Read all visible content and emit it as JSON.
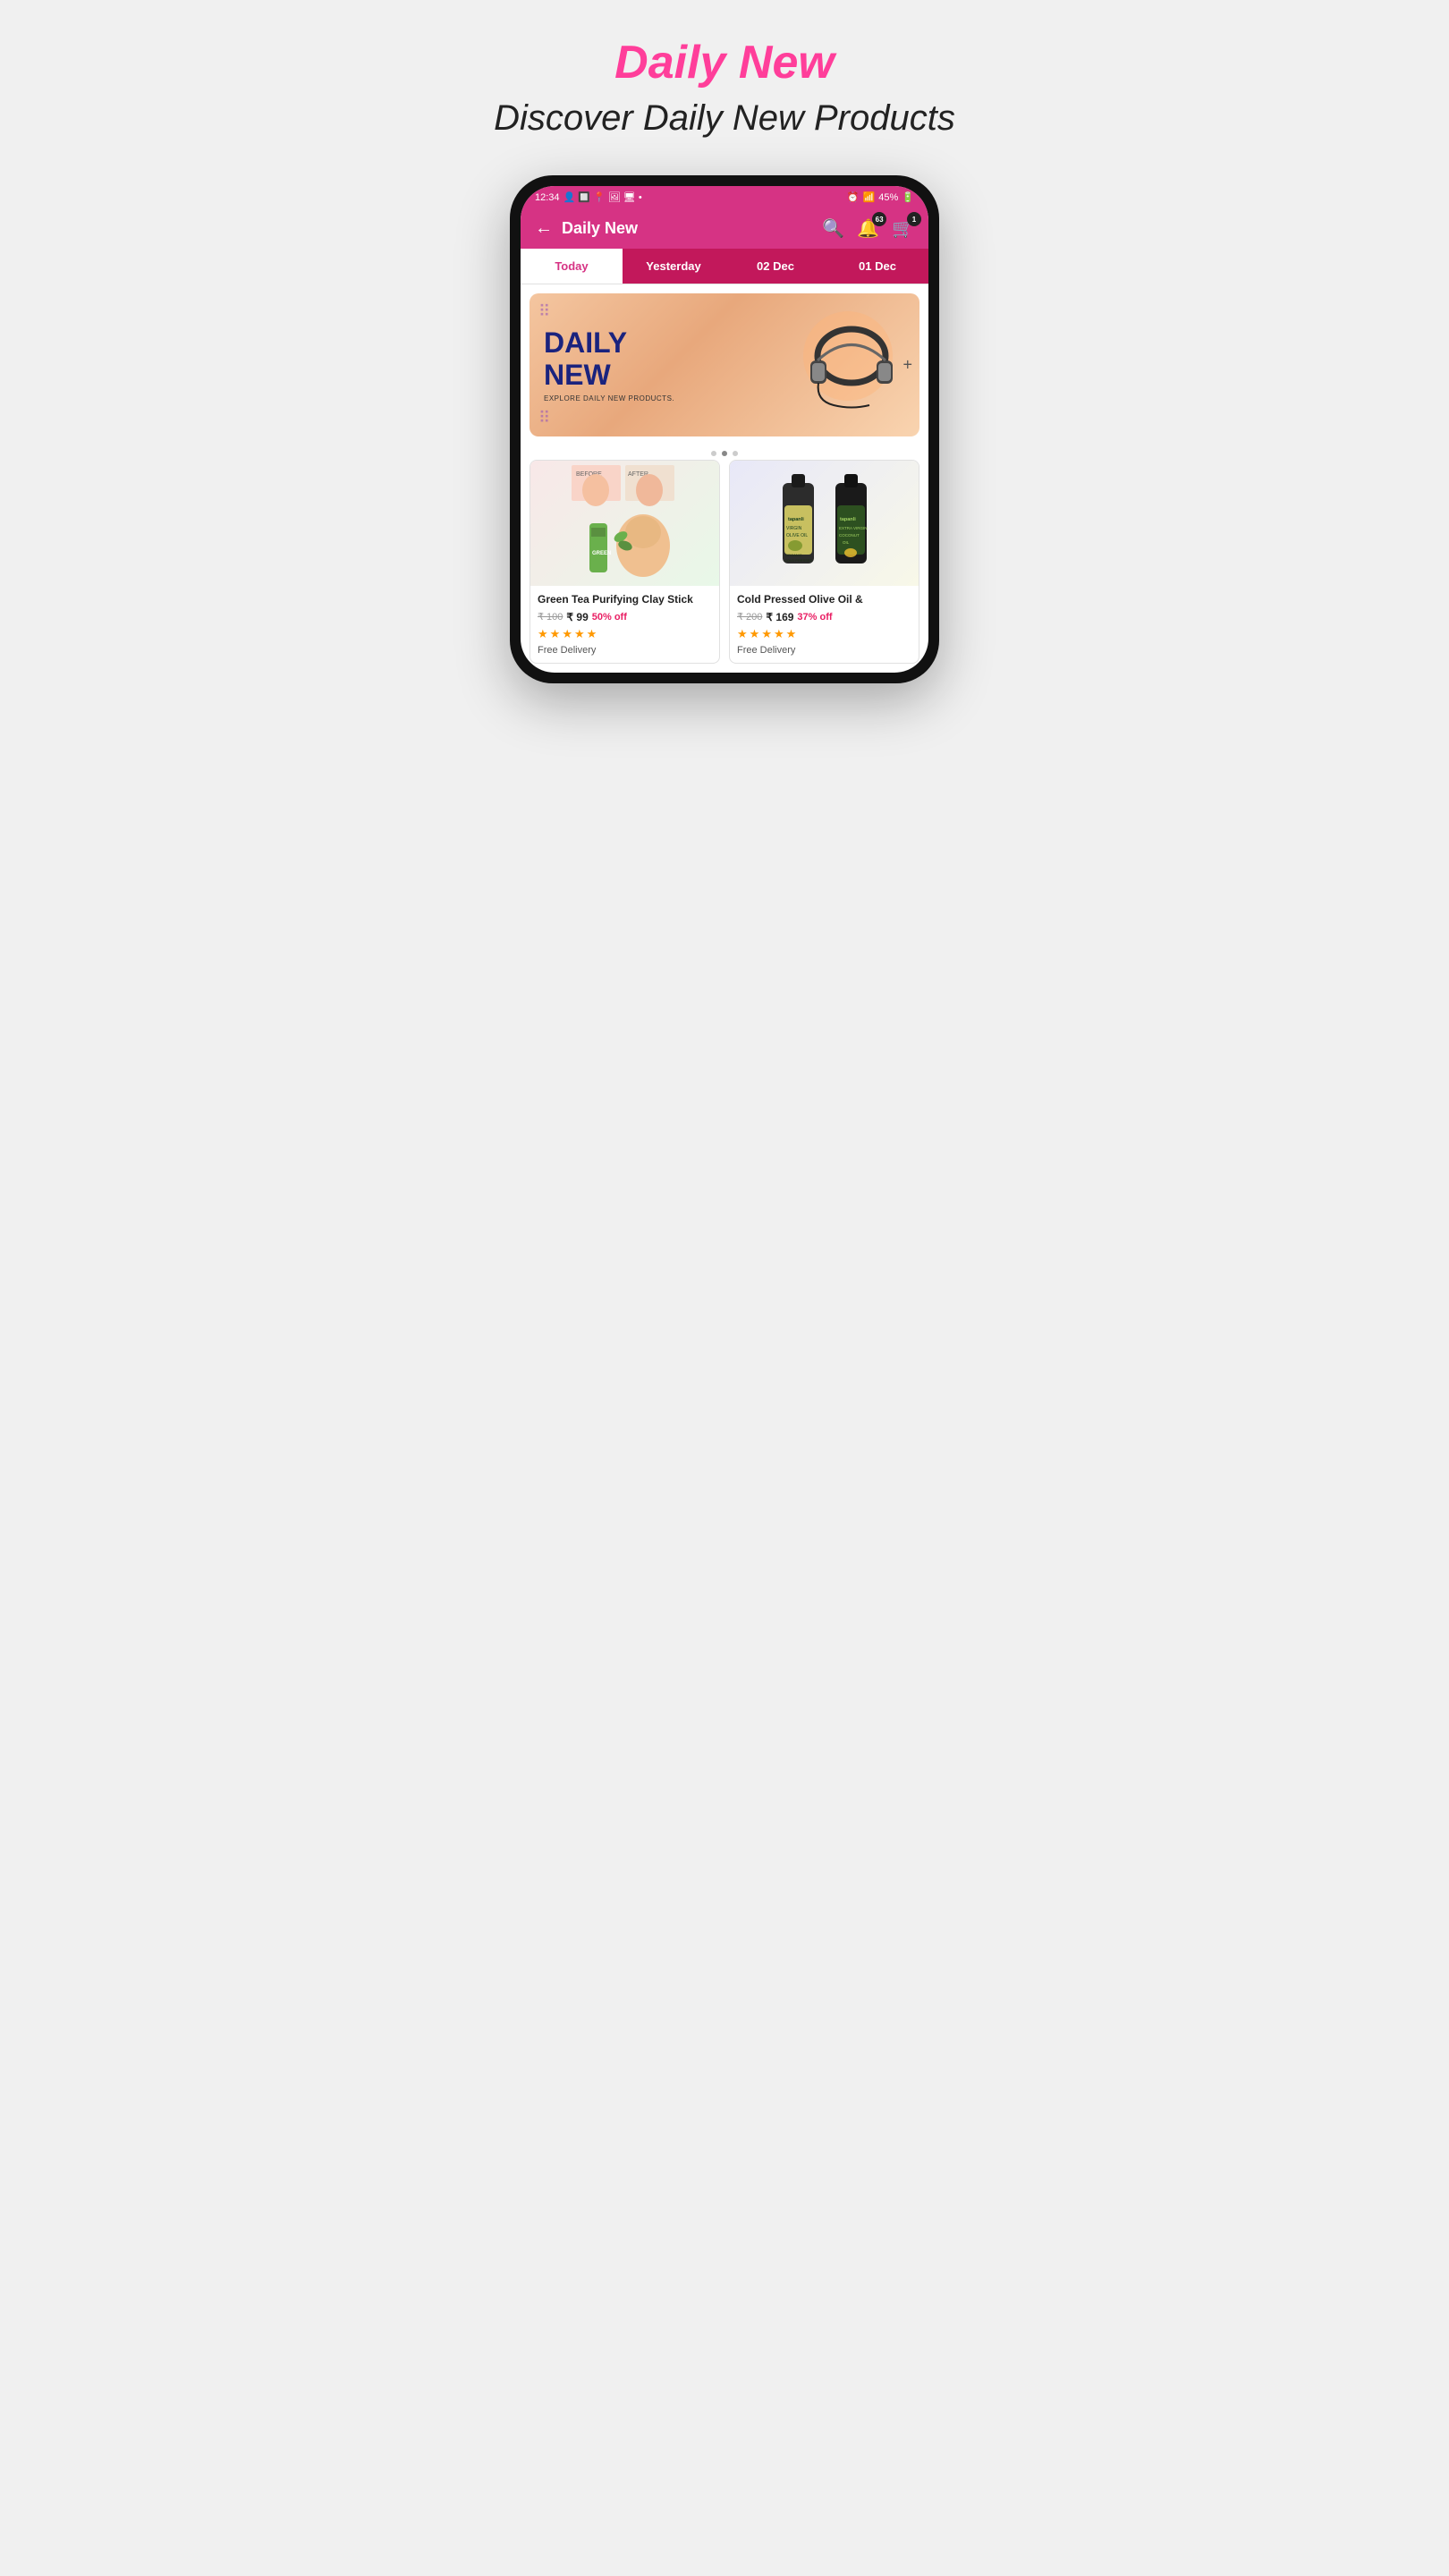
{
  "page": {
    "heading": "Daily New",
    "subtitle": "Discover Daily New Products"
  },
  "statusBar": {
    "time": "12:34",
    "battery": "45%",
    "signal": "Vo)) LTE1"
  },
  "header": {
    "title": "Daily New",
    "back_label": "←",
    "notification_count": "63",
    "cart_count": "1"
  },
  "tabs": [
    {
      "label": "Today",
      "active": true
    },
    {
      "label": "Yesterday",
      "active": false
    },
    {
      "label": "02 Dec",
      "active": false
    },
    {
      "label": "01 Dec",
      "active": false
    }
  ],
  "banner": {
    "title_line1": "DAILY",
    "title_line2": "NEW",
    "explore_text": "EXPLORE DAILY NEW PRODUCTS."
  },
  "products": [
    {
      "name": "Green Tea Purifying Clay Stick",
      "price_original": "₹ 100",
      "price_current": "₹ 99",
      "discount": "50% off",
      "stars": 5,
      "delivery": "Free Delivery",
      "type": "clay-stick"
    },
    {
      "name": "Cold Pressed Olive Oil &",
      "price_original": "₹ 200",
      "price_current": "₹ 169",
      "discount": "37% off",
      "stars": 5,
      "delivery": "Free Delivery",
      "type": "olive-oil"
    }
  ]
}
